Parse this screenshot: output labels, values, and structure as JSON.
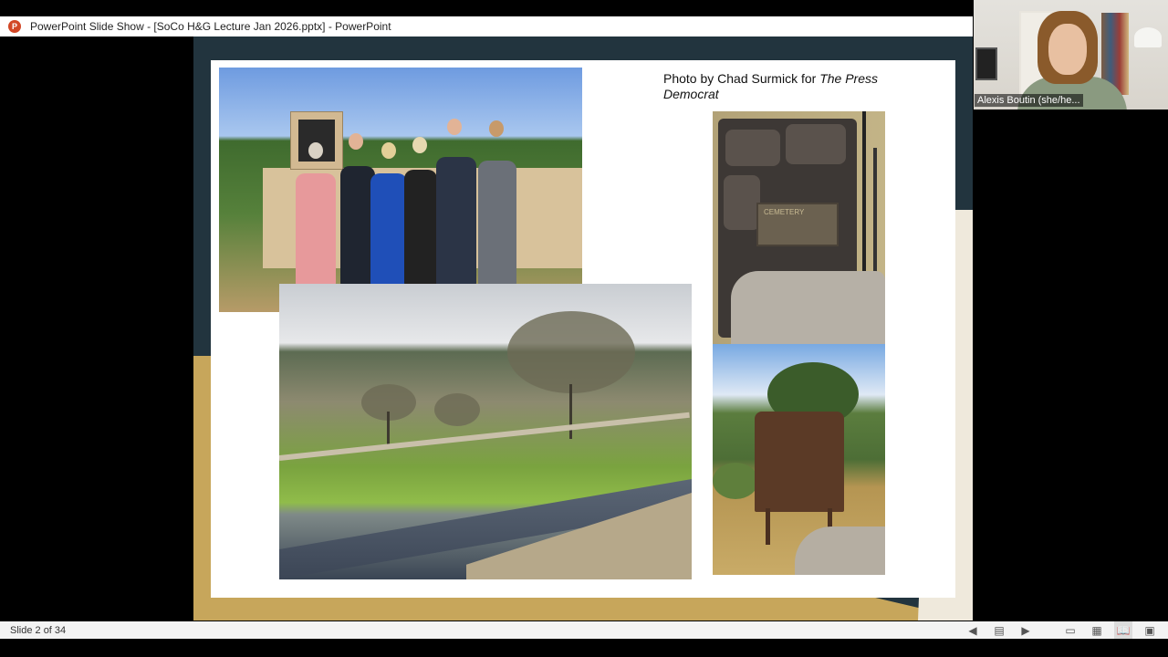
{
  "window": {
    "title": "PowerPoint Slide Show - [SoCo H&G Lecture Jan 2026.pptx] - PowerPoint",
    "app_icon": "powerpoint-icon",
    "app_icon_letter": "P"
  },
  "slide": {
    "caption_prefix": "Photo by Chad Surmick for ",
    "caption_italic": "The Press Democrat",
    "plaque_sign_text": "CEMETERY",
    "photos": [
      "group-photo",
      "landscape-memorial-photo",
      "stone-gate-photo",
      "rusty-sign-photo"
    ]
  },
  "webcam": {
    "participant_name": "Alexis Boutin (she/he..."
  },
  "status": {
    "slide_indicator": "Slide 2 of 34",
    "controls": [
      {
        "name": "previous-slide-icon",
        "glyph": "◀"
      },
      {
        "name": "slide-thumbnails-icon",
        "glyph": "▤"
      },
      {
        "name": "next-slide-icon",
        "glyph": "▶"
      },
      {
        "name": "normal-view-icon",
        "glyph": "▭"
      },
      {
        "name": "slide-sorter-icon",
        "glyph": "▦"
      },
      {
        "name": "reading-view-icon",
        "glyph": "📖"
      },
      {
        "name": "slide-show-icon",
        "glyph": "▣"
      }
    ]
  },
  "colors": {
    "stage_dark": "#22343e",
    "stage_gold": "#c7a65b",
    "powerpoint_red": "#d24726"
  }
}
